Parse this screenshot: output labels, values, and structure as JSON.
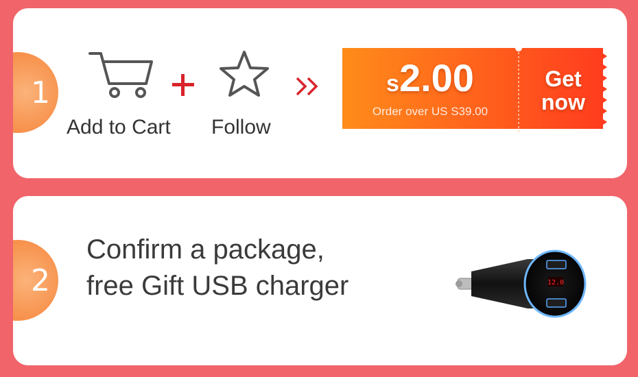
{
  "step1": {
    "badge": "1",
    "cart_label": "Add to Cart",
    "follow_label": "Follow",
    "icons": [
      "cart-icon",
      "plus-icon",
      "star-icon",
      "double-chevron-icon"
    ],
    "coupon": {
      "currency": "s",
      "amount": "2.00",
      "condition": "Order over US S39.00",
      "cta_line1": "Get",
      "cta_line2": "now"
    }
  },
  "step2": {
    "badge": "2",
    "text_line1": "Confirm a package,",
    "text_line2": "free Gift USB charger",
    "image": "usb-car-charger"
  },
  "colors": {
    "background": "#f0646a",
    "card": "#ffffff",
    "badge": "#f7924d",
    "coupon_start": "#ff8c1a",
    "coupon_end": "#ff3b1e",
    "accent_red": "#d8242b"
  }
}
